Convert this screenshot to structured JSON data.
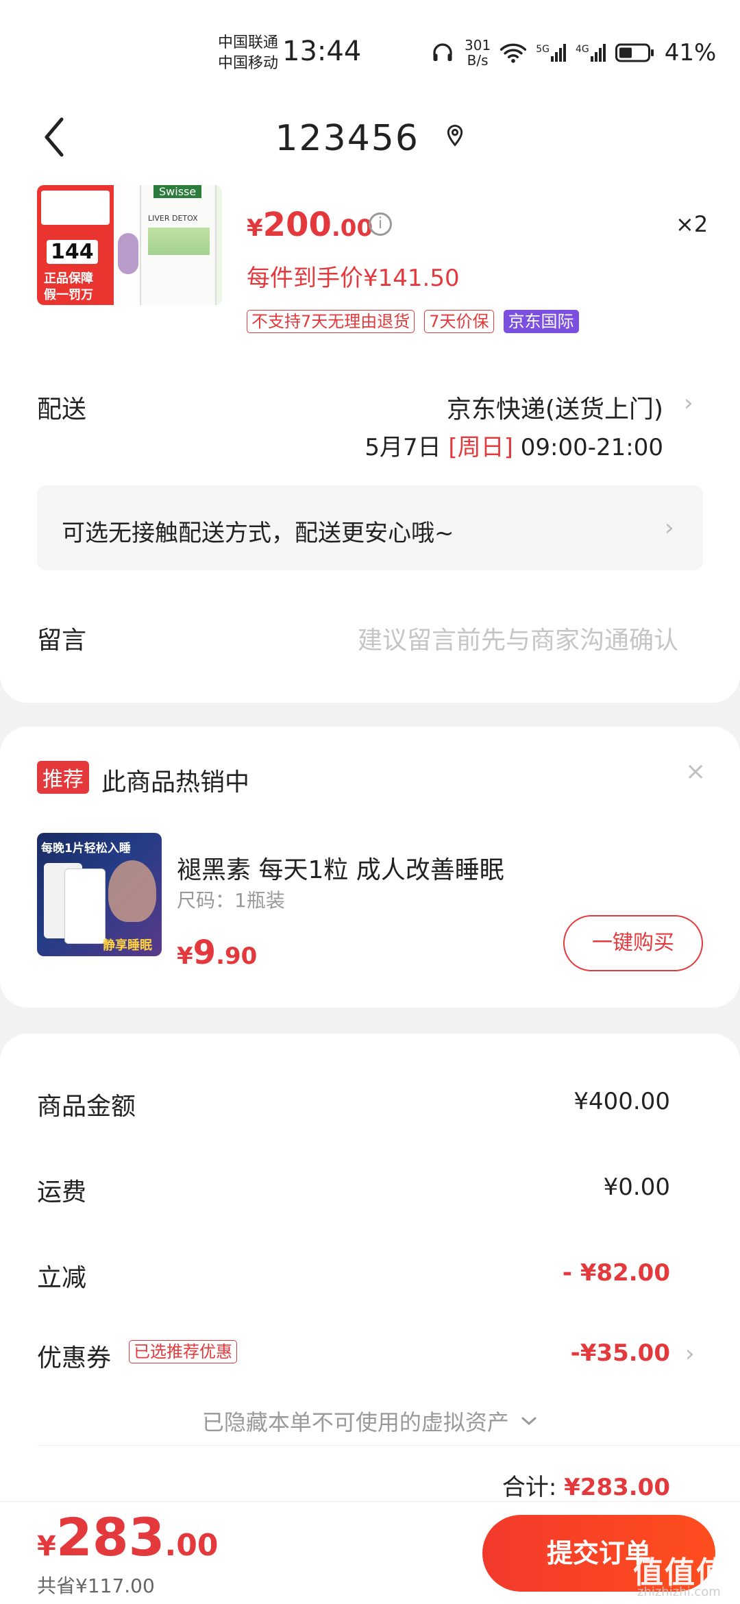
{
  "status_bar": {
    "carrier_1": "中国联通",
    "carrier_2": "中国移动",
    "time": "13:44",
    "net_speed_value": "301",
    "net_speed_unit": "B/s",
    "sig1_label": "5G",
    "sig2_label": "4G",
    "battery": "41%"
  },
  "nav": {
    "title": "123456"
  },
  "product": {
    "currency": "¥",
    "price_int": "200",
    "price_dec": ".00",
    "qty": "×2",
    "unit_price": "每件到手价¥141.50",
    "image_badge_number": "144",
    "image_badge_line1": "正品保障",
    "image_badge_line2": "假一罚万",
    "image_brand": "Swisse",
    "image_sub": "LIVER DETOX",
    "tags": [
      "不支持7天无理由退货",
      "7天价保",
      "京东国际"
    ]
  },
  "delivery": {
    "label": "配送",
    "method": "京东快递(送货上门)",
    "date": "5月7日",
    "weekday": "[周日]",
    "time": "09:00-21:00",
    "contactless": "可选无接触配送方式，配送更安心哦~"
  },
  "note": {
    "label": "留言",
    "placeholder": "建议留言前先与商家沟通确认"
  },
  "recommend": {
    "badge": "推荐",
    "title": "此商品热销中",
    "close": "×",
    "name": "褪黑素 每天1粒 成人改善睡眠",
    "spec": "尺码：1瓶装",
    "currency": "¥",
    "price_int": "9",
    "price_dec": ".90",
    "buy_label": "一键购买",
    "image_caption_top": "每晚1片轻松入睡",
    "image_caption_bottom": "静享睡眠"
  },
  "summary": {
    "goods_label": "商品金额",
    "goods_value": "¥400.00",
    "shipping_label": "运费",
    "shipping_value": "¥0.00",
    "discount_label": "立减",
    "discount_value": "- ¥82.00",
    "coupon_label": "优惠券",
    "coupon_tag": "已选推荐优惠",
    "coupon_value": "-¥35.00",
    "hidden_assets": "已隐藏本单不可使用的虚拟资产",
    "total_label": "合计:",
    "total_value": "¥283.00"
  },
  "bottom": {
    "currency": "¥",
    "price_int": "283",
    "price_dec": ".00",
    "saved": "共省¥117.00",
    "submit": "提交订单",
    "watermark": "值值值",
    "watermark_sub": "zhizhizhi.com"
  },
  "colors": {
    "accent": "#e4393c",
    "purple_tag": "#7b4fe0",
    "background": "#f2f2f2"
  }
}
